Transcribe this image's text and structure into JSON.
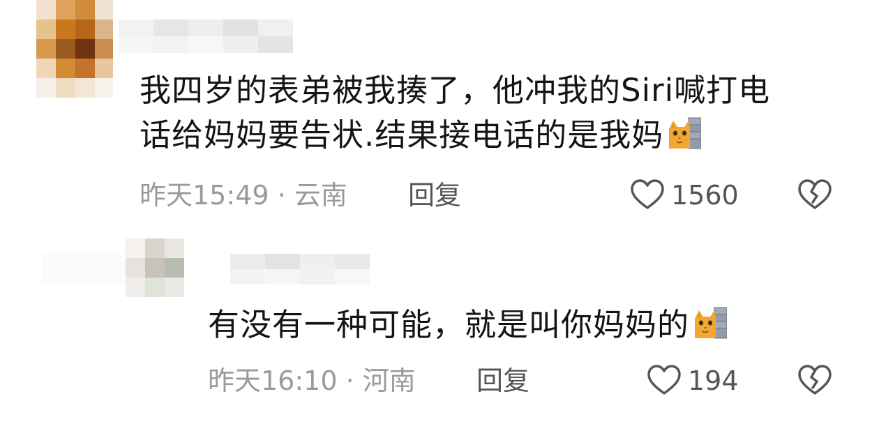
{
  "comments": [
    {
      "text_line1": "我四岁的表弟被我揍了，他冲我的Siri喊打电",
      "text_line2": "话给妈妈要告状.结果接电话的是我妈",
      "time": "昨天15:49",
      "separator": "·",
      "location": "云南",
      "reply_label": "回复",
      "likes": "1560",
      "emoji": "cat-peeking-icon"
    },
    {
      "text_line1": "有没有一种可能，就是叫你妈妈的",
      "time": "昨天16:10",
      "separator": "·",
      "location": "河南",
      "reply_label": "回复",
      "likes": "194",
      "emoji": "cat-peeking-icon"
    }
  ],
  "colors": {
    "text": "#141414",
    "meta": "#9a9a9a",
    "action": "#555555",
    "background": "#ffffff"
  }
}
